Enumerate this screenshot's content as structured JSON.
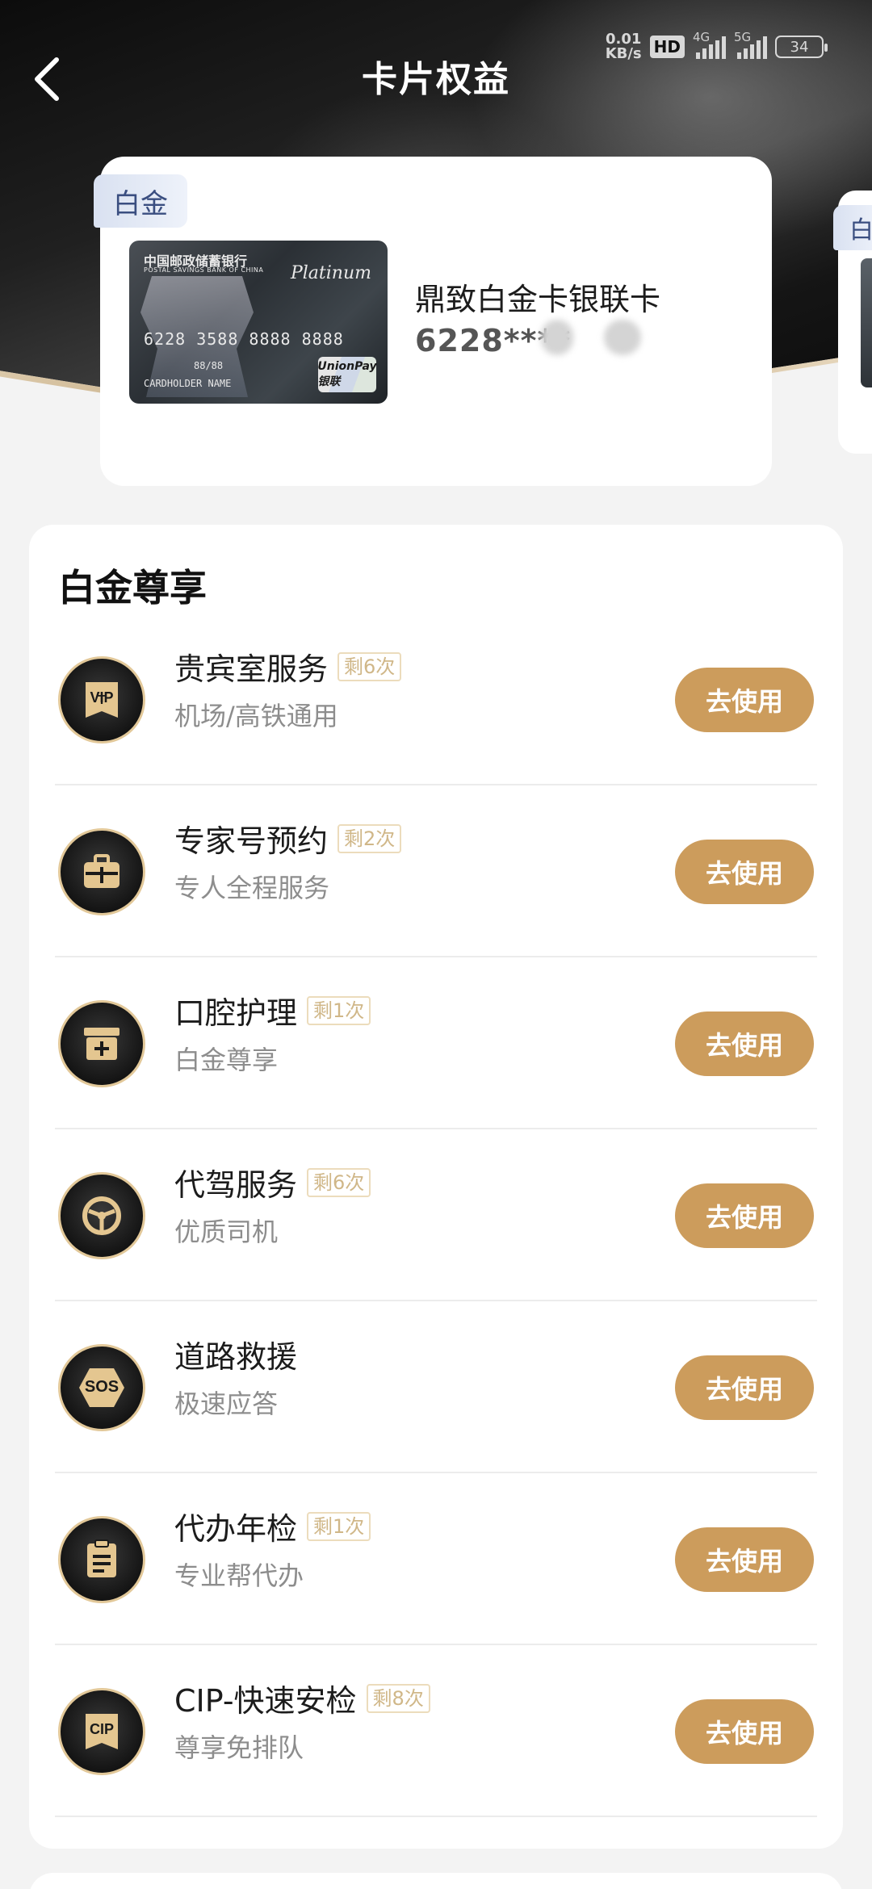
{
  "status_bar": {
    "net_speed_value": "0.01",
    "net_speed_unit": "KB/s",
    "hd_label": "HD",
    "sim1_label": "4G",
    "sim2_label": "5G",
    "battery": "34"
  },
  "header": {
    "title": "卡片权益"
  },
  "card": {
    "tier": "白金",
    "bank_name": "中国邮政储蓄银行",
    "bank_name_en": "POSTAL SAVINGS BANK OF CHINA",
    "card_level": "Platinum",
    "face_number": "6228 3588 8888 8888",
    "face_expiry": "88/88",
    "face_holder": "CARDHOLDER NAME",
    "network": "UnionPay 银联",
    "name": "鼎致白金卡银联卡",
    "number_masked": "6228****"
  },
  "next_card": {
    "tier": "白"
  },
  "section": {
    "title": "白金尊享"
  },
  "benefits": [
    {
      "name": "贵宾室服务",
      "badge": "剩6次",
      "desc": "机场/高铁通用",
      "icon": "vip-icon",
      "icon_text": "VIP",
      "action": "去使用"
    },
    {
      "name": "专家号预约",
      "badge": "剩2次",
      "desc": "专人全程服务",
      "icon": "medical-kit-icon",
      "icon_text": "",
      "action": "去使用"
    },
    {
      "name": "口腔护理",
      "badge": "剩1次",
      "desc": "白金尊享",
      "icon": "medical-box-icon",
      "icon_text": "",
      "action": "去使用"
    },
    {
      "name": "代驾服务",
      "badge": "剩6次",
      "desc": "优质司机",
      "icon": "steering-wheel-icon",
      "icon_text": "",
      "action": "去使用"
    },
    {
      "name": "道路救援",
      "badge": "",
      "desc": "极速应答",
      "icon": "sos-icon",
      "icon_text": "SOS",
      "action": "去使用"
    },
    {
      "name": "代办年检",
      "badge": "剩1次",
      "desc": "专业帮代办",
      "icon": "clipboard-icon",
      "icon_text": "",
      "action": "去使用"
    },
    {
      "name": "CIP-快速安检",
      "badge": "剩8次",
      "desc": "尊享免排队",
      "icon": "cip-icon",
      "icon_text": "CIP",
      "action": "去使用"
    }
  ],
  "colors": {
    "accent_gold": "#cc9c5c",
    "badge_gold": "#d0b788",
    "tier_blue": "#3a4e80"
  }
}
